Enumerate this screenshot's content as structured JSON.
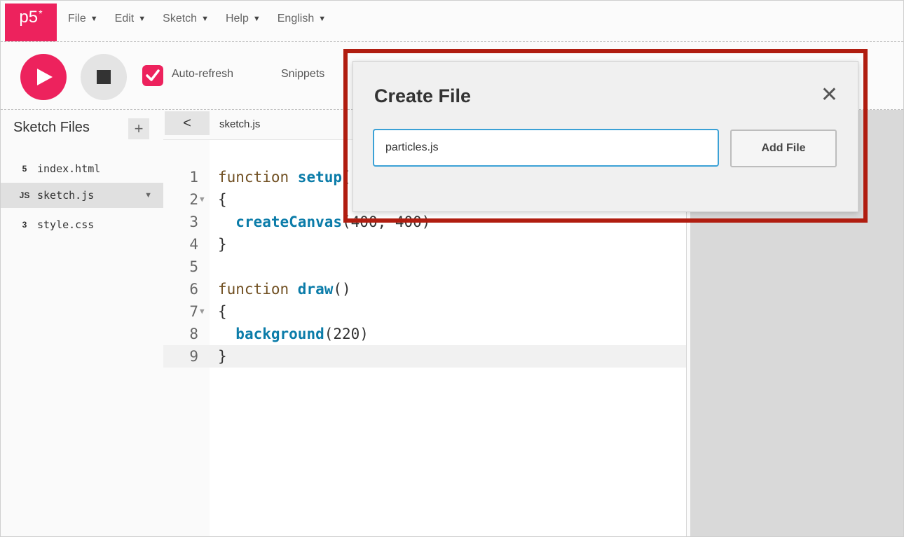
{
  "app": {
    "logo": "p5",
    "logo_sup": "*"
  },
  "menu": [
    {
      "label": "File"
    },
    {
      "label": "Edit"
    },
    {
      "label": "Sketch"
    },
    {
      "label": "Help"
    },
    {
      "label": "English"
    }
  ],
  "toolbar": {
    "auto_refresh_label": "Auto-refresh",
    "auto_refresh_checked": true,
    "snippets_label": "Snippets"
  },
  "sidebar": {
    "title": "Sketch Files",
    "add_symbol": "+",
    "files": [
      {
        "icon": "html-file-icon",
        "icon_glyph": "5",
        "name": "index.html"
      },
      {
        "icon": "js-file-icon",
        "icon_glyph": "JS",
        "name": "sketch.js",
        "selected": true
      },
      {
        "icon": "css-file-icon",
        "icon_glyph": "3",
        "name": "style.css"
      }
    ]
  },
  "editor": {
    "tab_name": "sketch.js",
    "lines": [
      {
        "n": "1",
        "parts": [
          [
            "kw",
            "function "
          ],
          [
            "fn",
            "setup"
          ],
          [
            "pn",
            "()"
          ]
        ]
      },
      {
        "n": "2",
        "fold": true,
        "parts": [
          [
            "pn",
            "{"
          ]
        ]
      },
      {
        "n": "3",
        "parts": [
          [
            "pn",
            "  "
          ],
          [
            "fn",
            "createCanvas"
          ],
          [
            "pn",
            "(400, 400)"
          ]
        ]
      },
      {
        "n": "4",
        "parts": [
          [
            "pn",
            "}"
          ]
        ]
      },
      {
        "n": "5",
        "parts": []
      },
      {
        "n": "6",
        "parts": [
          [
            "kw",
            "function "
          ],
          [
            "fn",
            "draw"
          ],
          [
            "pn",
            "()"
          ]
        ]
      },
      {
        "n": "7",
        "fold": true,
        "parts": [
          [
            "pn",
            "{"
          ]
        ]
      },
      {
        "n": "8",
        "parts": [
          [
            "pn",
            "  "
          ],
          [
            "fn",
            "background"
          ],
          [
            "pn",
            "(220)"
          ]
        ]
      },
      {
        "n": "9",
        "active": true,
        "parts": [
          [
            "pn",
            "}"
          ]
        ]
      }
    ]
  },
  "modal": {
    "title": "Create File",
    "close_symbol": "✕",
    "input_value": "particles.js",
    "add_button": "Add File"
  },
  "colors": {
    "accent": "#ed225d",
    "highlight": "#b01d10",
    "input_border": "#3ba1d6"
  }
}
